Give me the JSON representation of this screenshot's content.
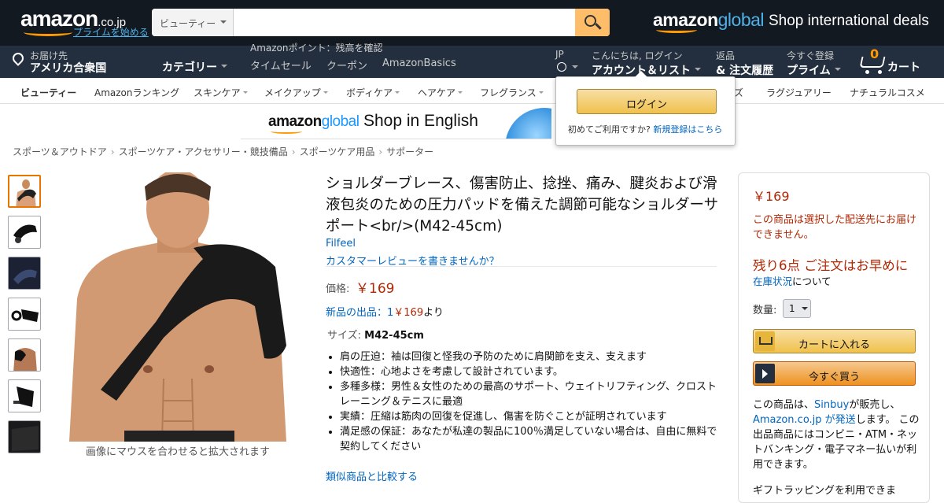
{
  "header": {
    "logo_text": "amazon",
    "logo_domain": ".co.jp",
    "prime_link": "プライムを始める",
    "search_category": "ビューティー",
    "search_placeholder": "",
    "global_logo_a": "amazon",
    "global_logo_b": "global",
    "intl_deals": "Shop international deals",
    "deliver_l1": "お届け先",
    "deliver_l2": "アメリカ合衆国",
    "category_label": "カテゴリー",
    "points_text": "Amazonポイント：残高を確認",
    "nav_links": [
      "タイムセール",
      "クーポン",
      "AmazonBasics"
    ],
    "lang_code": "JP",
    "account_l1": "こんにちは, ログイン",
    "account_l2": "アカウント＆リスト",
    "orders_l1": "返品",
    "orders_l2": "& 注文履歴",
    "prime_l1": "今すぐ登録",
    "prime_l2": "プライム",
    "cart_count": "0",
    "cart_label": "カート",
    "accent_color": "#febd69"
  },
  "subnav": {
    "items": [
      "ビューティー",
      "Amazonランキング",
      "スキンケア",
      "メイクアップ",
      "ボディケア",
      "ヘアケア",
      "フレグランス",
      "ズ",
      "ラグジュアリー",
      "ナチュラルコスメ"
    ]
  },
  "banner": {
    "logo_a": "amazon",
    "logo_b": "global",
    "text": "Shop in English"
  },
  "breadcrumb": [
    "スポーツ＆アウトドア",
    "スポーツケア・アクセサリー・競技備品",
    "スポーツケア用品",
    "サポーター"
  ],
  "product": {
    "title": "ショルダーブレース、傷害防止、捻挫、痛み、腱炎および滑液包炎のための圧力パッドを備えた調節可能なショルダーサポート<br/>(M42-45cm)",
    "brand": "Filfeel",
    "review_link": "カスタマーレビューを書きませんか？",
    "price_label": "価格:",
    "price": "￥169",
    "new_offers_a": "新品の出品：1",
    "new_offers_price": "￥169",
    "new_offers_suffix": "より",
    "size_label": "サイズ:",
    "size_value": "M42-45cm",
    "bullets": [
      "肩の圧迫：袖は回復と怪我の予防のために肩関節を支え、支えます",
      "快適性：心地よさを考慮して設計されています。",
      "多種多様：男性＆女性のための最高のサポート、ウェイトリフティング、クロストレーニング＆テニスに最適",
      "実績：圧縮は筋肉の回復を促進し、傷害を防ぐことが証明されています",
      "満足感の保証：あなたが私達の製品に100％満足していない場合は、自由に無料で契約してください"
    ],
    "compare_link": "類似商品と比較する",
    "zoom_hint": "画像にマウスを合わせると拡大されます"
  },
  "buybox": {
    "price": "￥169",
    "ship_warning": "この商品は選択した配送先にお届けできません。",
    "stock": "残り6点 ご注文はお早めに",
    "stock_link": "在庫状況",
    "stock_suffix": "について",
    "qty_label": "数量:",
    "qty_value": "1",
    "add_to_cart": "カートに入れる",
    "buy_now": "今すぐ買う",
    "seller_pre": "この商品は、",
    "seller_name": "Sinbuy",
    "seller_mid": "が販売し、",
    "fulfiller": "Amazon.co.jp が発送",
    "seller_post": "します。 この出品商品にはコンビニ・ATM・ネットバンキング・電子マネー払いが利用できます。",
    "gift": "ギフトラッピングを利用できま"
  },
  "popover": {
    "login": "ログイン",
    "new_text": "初めてご利用ですか?",
    "new_link": "新規登録はこちら"
  }
}
